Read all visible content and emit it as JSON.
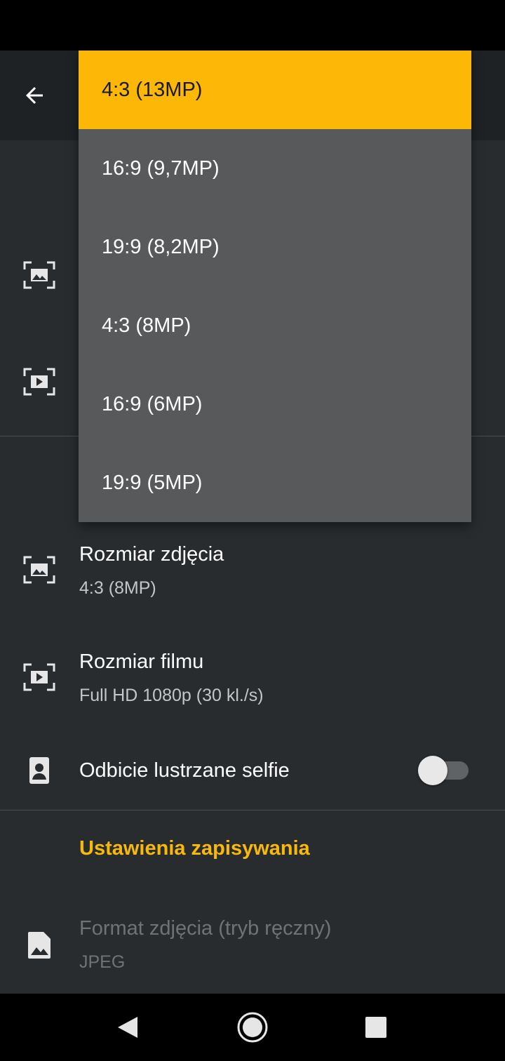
{
  "camera_section": {
    "photo_size": {
      "title": "Rozmiar zdjęcia",
      "value": "4:3 (8MP)",
      "icon": "photo-size-icon"
    },
    "video_size": {
      "title": "Rozmiar filmu",
      "value": "Full HD 1080p (30 kl./s)",
      "icon": "video-size-icon"
    },
    "mirror_selfie": {
      "title": "Odbicie lustrzane selfie",
      "enabled": false,
      "icon": "selfie-portrait-icon"
    }
  },
  "save_section": {
    "header": "Ustawienia zapisywania",
    "photo_format": {
      "title": "Format zdjęcia (tryb ręczny)",
      "value": "JPEG",
      "disabled": true,
      "icon": "image-icon"
    }
  },
  "dropdown": {
    "selected_index": 0,
    "options": [
      "4:3 (13MP)",
      "16:9 (9,7MP)",
      "19:9 (8,2MP)",
      "4:3 (8MP)",
      "16:9 (6MP)",
      "19:9 (5MP)"
    ]
  },
  "nav": {
    "back_icon": "arrow-left-icon"
  },
  "system_nav": {
    "back": "triangle-back-icon",
    "home": "circle-home-icon",
    "recents": "square-recents-icon"
  },
  "colors": {
    "accent": "#fdb707",
    "background": "#282c2f",
    "menu": "#57595b"
  }
}
